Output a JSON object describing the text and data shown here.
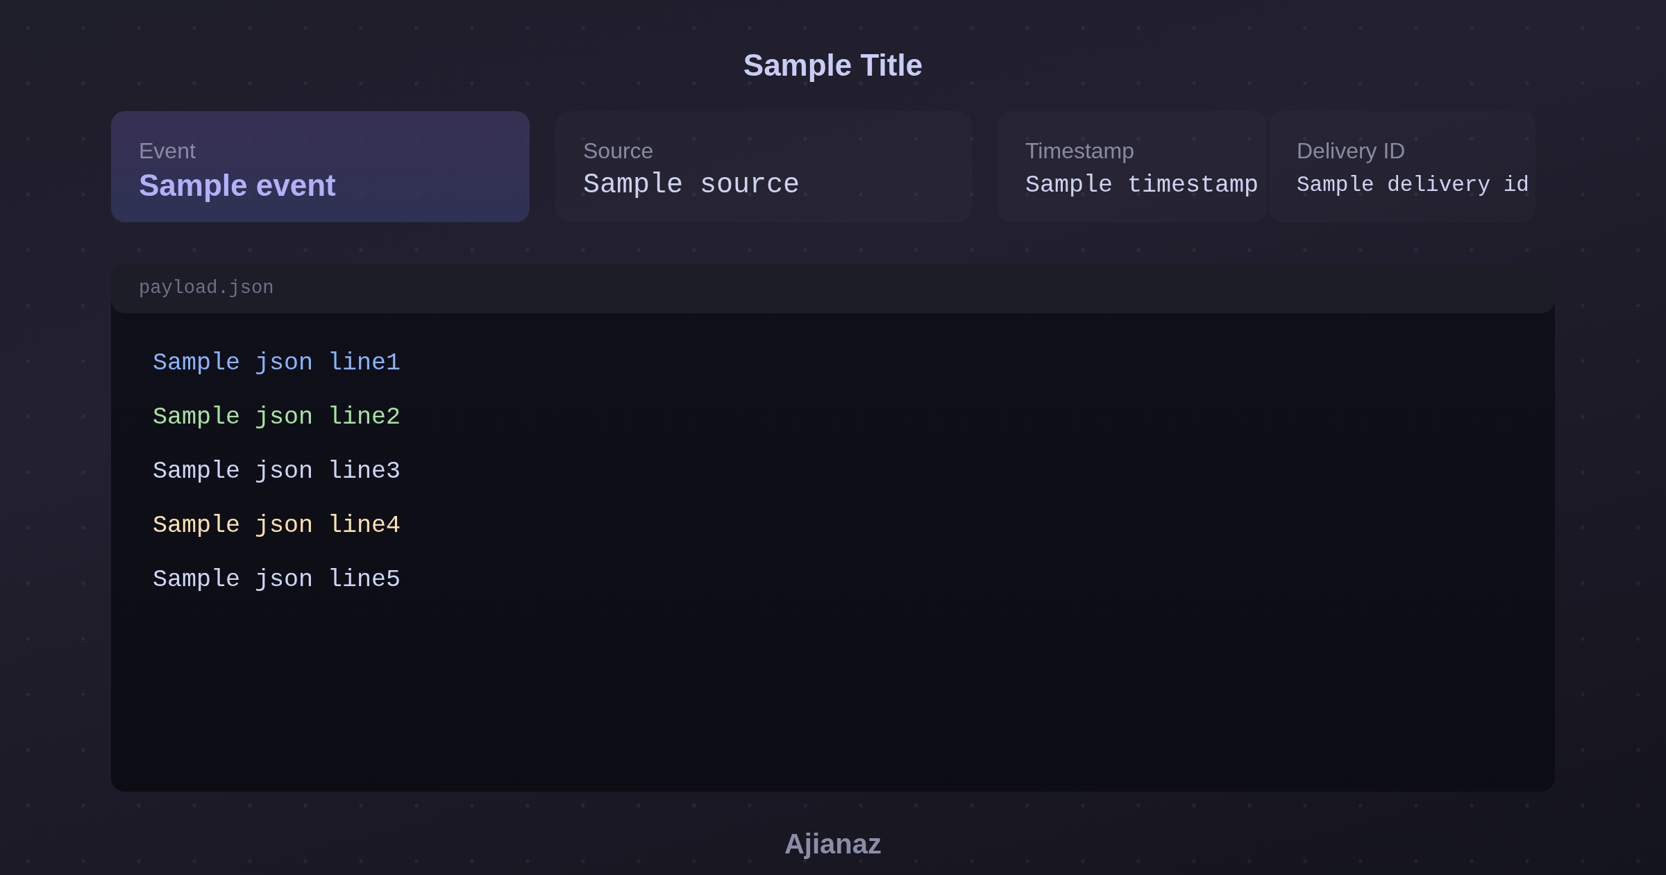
{
  "title": "Sample Title",
  "fields": [
    {
      "label": "Event",
      "value": "Sample event",
      "highlighted": true
    },
    {
      "label": "Source",
      "value": "Sample source",
      "highlighted": false
    },
    {
      "label": "Timestamp",
      "value": "Sample timestamp",
      "highlighted": false
    },
    {
      "label": "Delivery ID",
      "value": "Sample delivery id",
      "highlighted": false
    }
  ],
  "code_panel": {
    "filename": "payload.json",
    "lines": [
      {
        "text": "Sample json line1",
        "color": "#89b4fa"
      },
      {
        "text": "Sample json line2",
        "color": "#a6e3a1"
      },
      {
        "text": "Sample json line3",
        "color": "#cdd6f4"
      },
      {
        "text": "Sample json line4",
        "color": "#f9e2af"
      },
      {
        "text": "Sample json line5",
        "color": "#cdd6f4"
      }
    ]
  },
  "footer": "Ajianaz"
}
